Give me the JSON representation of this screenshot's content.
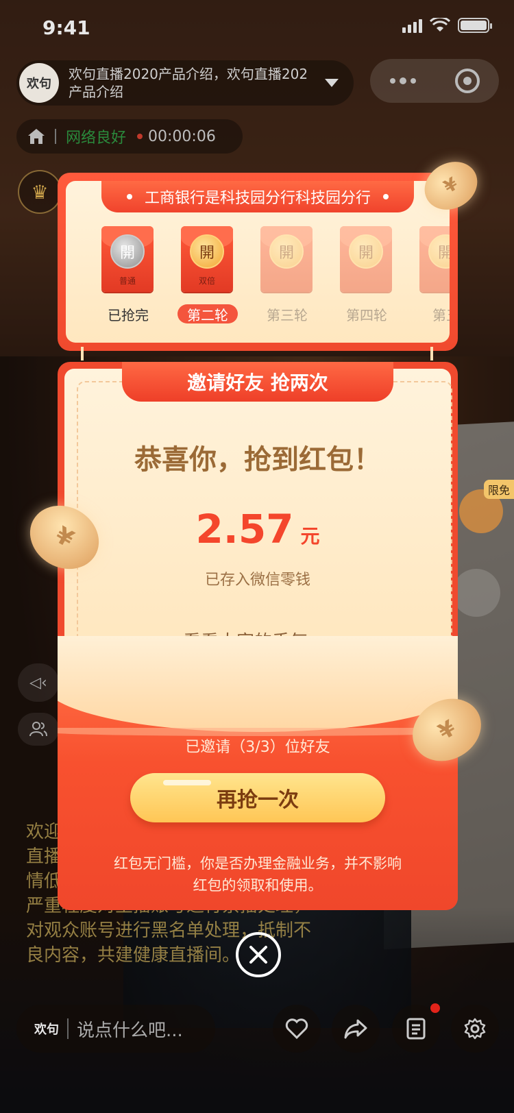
{
  "status_bar": {
    "time": "9:41"
  },
  "header": {
    "avatar_text": "欢句",
    "title": "欢句直播2020产品介绍，欢句直播202产品介绍"
  },
  "network": {
    "quality": "网络良好",
    "timer": "00:00:06"
  },
  "red_packet_stage": {
    "header_title": "工商银行是科技园分行科技园分行",
    "packets": [
      {
        "coin_text": "開",
        "sub_text": "普通",
        "label": "已抢完",
        "state": "done"
      },
      {
        "coin_text": "開",
        "sub_text": "双倍",
        "label": "第二轮",
        "state": "active"
      },
      {
        "coin_text": "開",
        "sub_text": "",
        "label": "第三轮",
        "state": "upcoming"
      },
      {
        "coin_text": "開",
        "sub_text": "",
        "label": "第四轮",
        "state": "upcoming"
      },
      {
        "coin_text": "開",
        "sub_text": "",
        "label": "第五",
        "state": "upcoming"
      }
    ]
  },
  "result_card": {
    "tab_title": "邀请好友 抢两次",
    "congrats": "恭喜你，抢到红包！",
    "amount": "2.57",
    "unit": "元",
    "saved_text": "已存入微信零钱",
    "luck_link": "看看大家的手气",
    "invited_text": "已邀请（3/3）位好友",
    "again_button": "再抢一次",
    "fineprint": "红包无门槛，你是否办理金融业务，并不影响红包的领取和使用。"
  },
  "side": {
    "limited_free_tag": "限免"
  },
  "notice_text": "欢迎来到直播间！欢句倡导绿色健康直播，若直播间内出现违法违规、色情低俗、暴力等内容，平台将视情节严重程度对主播账号进行禁播处理，对观众账号进行黑名单处理，抵制不良内容，共建健康直播间。",
  "bottom_bar": {
    "logo_text": "欢句",
    "input_placeholder": "说点什么吧..."
  },
  "colors": {
    "accent_red": "#f04a2e",
    "gold": "#ffc655",
    "network_green": "#2a8a3c"
  },
  "icons": [
    "home-icon",
    "crown-icon",
    "speaker-icon",
    "people-icon",
    "heart-icon",
    "share-icon",
    "document-icon",
    "gear-icon",
    "close-icon",
    "chevron-right-icon"
  ]
}
